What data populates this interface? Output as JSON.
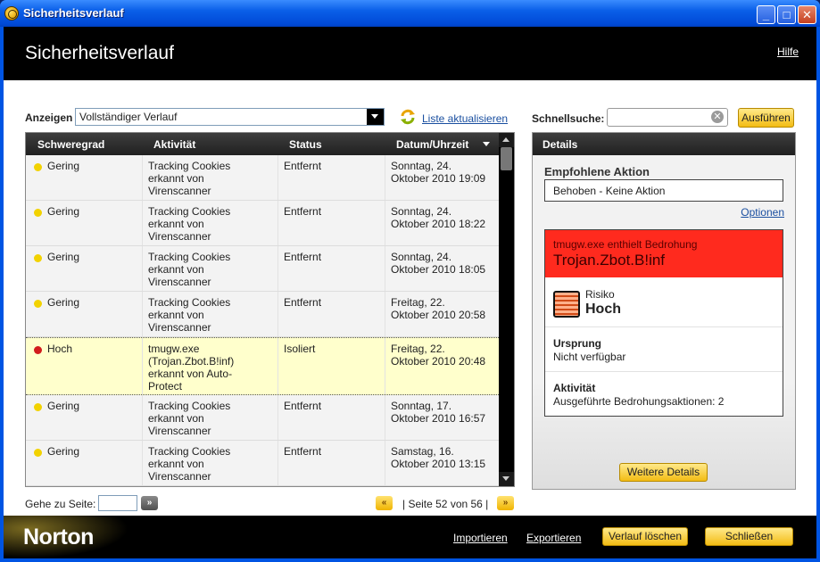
{
  "window": {
    "title": "Sicherheitsverlauf"
  },
  "header": {
    "title": "Sicherheitsverlauf",
    "help_link": "Hilfe"
  },
  "filter": {
    "label": "Anzeigen",
    "selected": "Vollständiger Verlauf",
    "refresh_link": "Liste aktualisieren"
  },
  "table": {
    "columns": [
      "Schweregrad",
      "Aktivität",
      "Status",
      "Datum/Uhrzeit"
    ],
    "rows": [
      {
        "severity": "Gering",
        "activity": [
          "Tracking Cookies",
          "erkannt von",
          "Virenscanner"
        ],
        "status": "Entfernt",
        "date": [
          "Sonntag, 24.",
          "Oktober 2010 19:09"
        ]
      },
      {
        "severity": "Gering",
        "activity": [
          "Tracking Cookies",
          "erkannt von",
          "Virenscanner"
        ],
        "status": "Entfernt",
        "date": [
          "Sonntag, 24.",
          "Oktober 2010 18:22"
        ]
      },
      {
        "severity": "Gering",
        "activity": [
          "Tracking Cookies",
          "erkannt von",
          "Virenscanner"
        ],
        "status": "Entfernt",
        "date": [
          "Sonntag, 24.",
          "Oktober 2010 18:05"
        ]
      },
      {
        "severity": "Gering",
        "activity": [
          "Tracking Cookies",
          "erkannt von",
          "Virenscanner"
        ],
        "status": "Entfernt",
        "date": [
          "Freitag, 22.",
          "Oktober 2010 20:58"
        ]
      },
      {
        "severity": "Hoch",
        "activity": [
          "tmugw.exe",
          "(Trojan.Zbot.B!inf)",
          "erkannt von Auto-",
          "Protect"
        ],
        "status": "Isoliert",
        "date": [
          "Freitag, 22.",
          "Oktober 2010 20:48"
        ]
      },
      {
        "severity": "Gering",
        "activity": [
          "Tracking Cookies",
          "erkannt von",
          "Virenscanner"
        ],
        "status": "Entfernt",
        "date": [
          "Sonntag, 17.",
          "Oktober 2010 16:57"
        ]
      },
      {
        "severity": "Gering",
        "activity": [
          "Tracking Cookies",
          "erkannt von",
          "Virenscanner"
        ],
        "status": "Entfernt",
        "date": [
          "Samstag, 16.",
          "Oktober 2010 13:15"
        ]
      }
    ]
  },
  "pagination": {
    "goto_label": "Gehe zu Seite:",
    "page_text": "| Seite 52 von 56 |"
  },
  "quicksearch": {
    "label": "Schnellsuche:",
    "value": "",
    "button": "Ausführen"
  },
  "details": {
    "header": "Details",
    "recommended_label": "Empfohlene Aktion",
    "recommended_value": "Behoben - Keine Aktion",
    "options_link": "Optionen",
    "threat_line1": "tmugw.exe enthielt Bedrohung",
    "threat_name": "Trojan.Zbot.B!inf",
    "risk_label": "Risiko",
    "risk_value": "Hoch",
    "origin_label": "Ursprung",
    "origin_value": "Nicht verfügbar",
    "activity_label": "Aktivität",
    "activity_value": "Ausgeführte Bedrohungsaktionen: 2",
    "more_button": "Weitere Details"
  },
  "footer": {
    "logo": "Norton",
    "import_link": "Importieren",
    "export_link": "Exportieren",
    "clear_button": "Verlauf löschen",
    "close_button": "Schließen"
  },
  "colors": {
    "severity_low": "#f2d200",
    "severity_high": "#d21c1c",
    "threat_banner": "#ff2a1e",
    "accent_button": "#f3bc14"
  }
}
